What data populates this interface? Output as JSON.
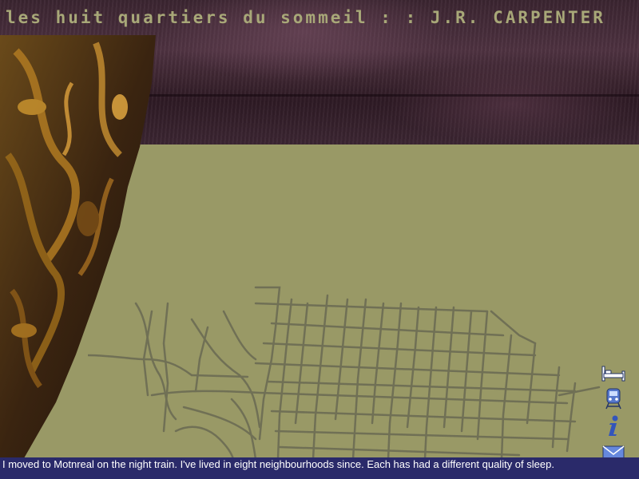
{
  "header": {
    "title": "les huit quartiers du sommeil : : J.R. CARPENTER"
  },
  "nav": {
    "items": [
      {
        "icon": "bed-icon",
        "label": "sleep"
      },
      {
        "icon": "train-icon",
        "label": "train"
      },
      {
        "icon": "info-icon",
        "label": "info"
      },
      {
        "icon": "envelope-icon",
        "label": "mail"
      }
    ]
  },
  "caption": {
    "text": "I moved to Motnreal on the night train. I've lived in eight neighbourhoods since. Each has had a different quality of sleep."
  },
  "colors": {
    "background": "#999966",
    "banner": "#3a2430",
    "title": "#a8a878",
    "map_lines": "#707055",
    "caption_bg": "#2a2a6a",
    "icon_blue": "#3355bb"
  }
}
